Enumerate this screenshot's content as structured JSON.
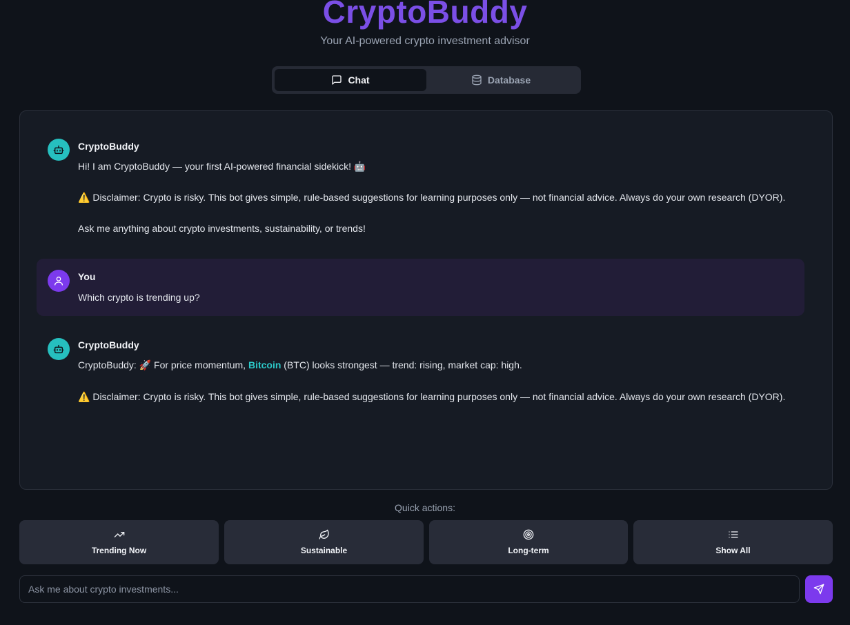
{
  "header": {
    "title": "CryptoBuddy",
    "subtitle": "Your AI-powered crypto investment advisor"
  },
  "tabs": [
    {
      "label": "Chat",
      "icon": "chat-bubble-icon",
      "active": true
    },
    {
      "label": "Database",
      "icon": "database-icon",
      "active": false
    }
  ],
  "messages": [
    {
      "role": "bot",
      "sender": "CryptoBuddy",
      "greeting": "Hi! I am CryptoBuddy — your first AI-powered financial sidekick! 🤖",
      "disclaimer": "Disclaimer: Crypto is risky. This bot gives simple, rule-based suggestions for learning purposes only — not financial advice. Always do your own research (DYOR).",
      "prompt": "Ask me anything about crypto investments, sustainability, or trends!"
    },
    {
      "role": "user",
      "sender": "You",
      "text": "Which crypto is trending up?"
    },
    {
      "role": "bot",
      "sender": "CryptoBuddy",
      "answer_prefix": "CryptoBuddy: 🚀 For price momentum, ",
      "answer_highlight": "Bitcoin",
      "answer_suffix": " (BTC) looks strongest — trend: rising, market cap: high.",
      "disclaimer": "Disclaimer: Crypto is risky. This bot gives simple, rule-based suggestions for learning purposes only — not financial advice. Always do your own research (DYOR)."
    }
  ],
  "warning_glyph": "⚠️",
  "quick_actions": {
    "label": "Quick actions:",
    "items": [
      {
        "label": "Trending Now",
        "icon": "trending-up-icon"
      },
      {
        "label": "Sustainable",
        "icon": "leaf-icon"
      },
      {
        "label": "Long-term",
        "icon": "target-icon"
      },
      {
        "label": "Show All",
        "icon": "list-icon"
      }
    ]
  },
  "input": {
    "placeholder": "Ask me about crypto investments...",
    "value": ""
  },
  "colors": {
    "brand": "#7b4fe6",
    "bot_avatar": "#26bfbf",
    "user_avatar": "#7c3aed",
    "highlight": "#2cc8c8",
    "send_button": "#7c3aed"
  }
}
